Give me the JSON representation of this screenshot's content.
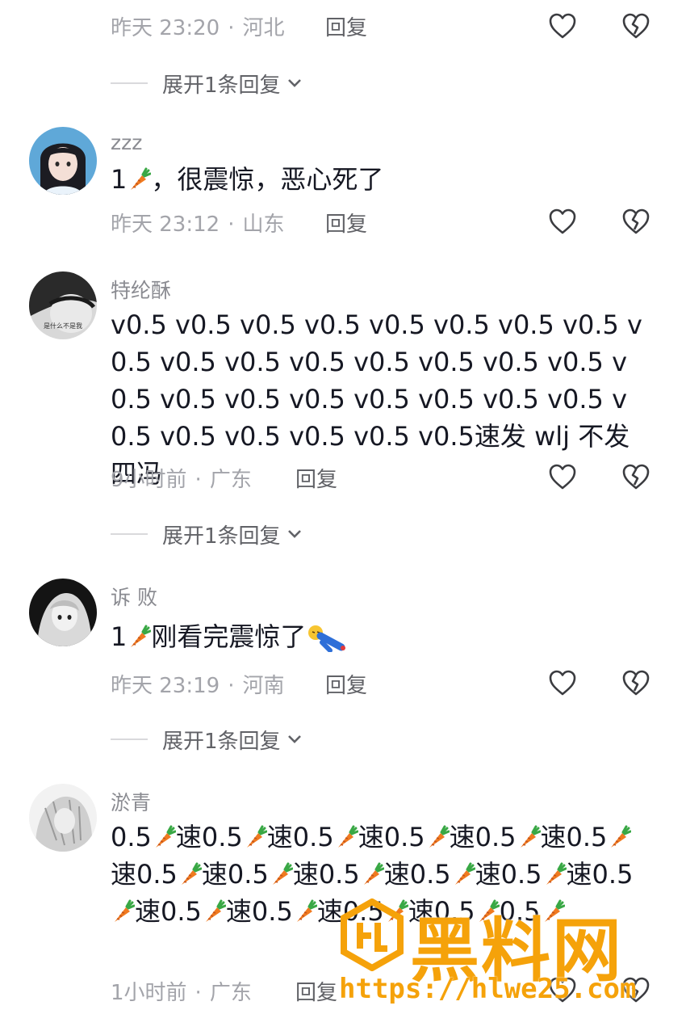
{
  "comments": [
    {
      "meta_time": "昨天 23:20",
      "meta_region": "河北",
      "reply_label": "回复",
      "expand_label": "展开1条回复"
    },
    {
      "username": "zzz",
      "text_prefix": "1",
      "text_suffix": "，很震惊，恶心死了",
      "meta_time": "昨天 23:12",
      "meta_region": "山东",
      "reply_label": "回复"
    },
    {
      "username": "特纶酥",
      "avatar_text": "是什么不是我",
      "text": "v0.5 v0.5 v0.5 v0.5 v0.5 v0.5 v0.5 v0.5 v0.5 v0.5 v0.5 v0.5 v0.5 v0.5 v0.5 v0.5 v0.5 v0.5 v0.5 v0.5 v0.5 v0.5 v0.5 v0.5 v0.5 v0.5 v0.5 v0.5 v0.5 v0.5速发 wlj 不发四冯",
      "meta_time": "9小时前",
      "meta_region": "广东",
      "reply_label": "回复",
      "expand_label": "展开1条回复"
    },
    {
      "username": "诉 败",
      "text_prefix": "1",
      "text_suffix": "刚看完震惊了",
      "meta_time": "昨天 23:19",
      "meta_region": "河南",
      "reply_label": "回复",
      "expand_label": "展开1条回复"
    },
    {
      "username": "淤青",
      "text_lines": [
        "0.5",
        "速0.5",
        "速0.5",
        "速0.5",
        "速0.5",
        "速0.5",
        "速0.5",
        "速0.5",
        "速0.5",
        "速0.5",
        "速0.5",
        "速0.5",
        "速0.5",
        "速0.5",
        "速0.5",
        "速0.5",
        "0.5"
      ],
      "meta_time": "1小时前",
      "meta_region": "广东",
      "reply_label": "回复"
    }
  ],
  "separator": "·",
  "icons": {
    "like": "heart-outline-icon",
    "dislike": "broken-heart-icon",
    "chevron": "chevron-down-icon",
    "emoji": "carrot-emoji"
  },
  "watermark": {
    "title": "黑料网",
    "url": "https://hlwe25.com",
    "color": "#f5a20a"
  }
}
